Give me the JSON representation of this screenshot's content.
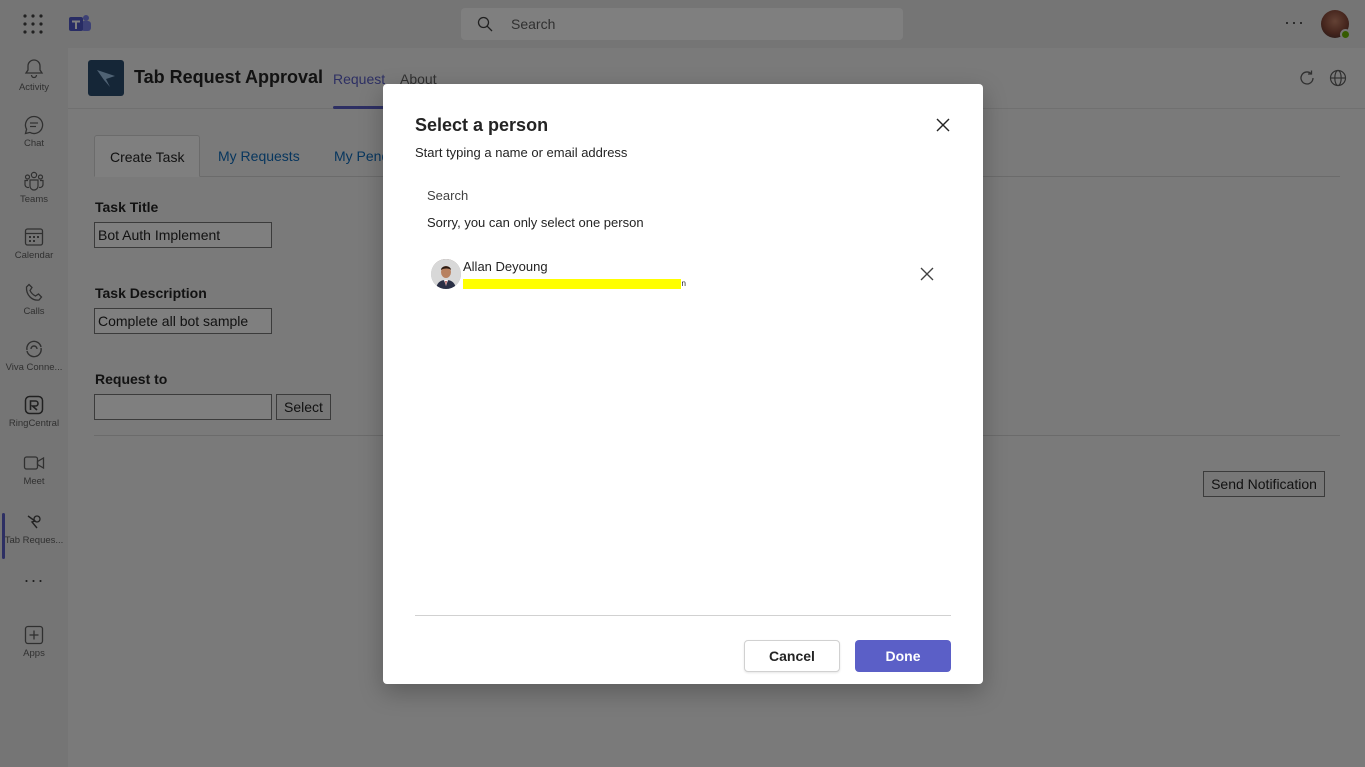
{
  "topbar": {
    "search_placeholder": "Search",
    "more_label": "···"
  },
  "rail": {
    "items": [
      {
        "label": "Activity",
        "icon": "bell-icon"
      },
      {
        "label": "Chat",
        "icon": "chat-icon"
      },
      {
        "label": "Teams",
        "icon": "teams-icon"
      },
      {
        "label": "Calendar",
        "icon": "calendar-icon"
      },
      {
        "label": "Calls",
        "icon": "phone-icon"
      },
      {
        "label": "Viva Conne...",
        "icon": "viva-icon"
      },
      {
        "label": "RingCentral",
        "icon": "ringcentral-icon"
      },
      {
        "label": "Meet",
        "icon": "video-icon"
      },
      {
        "label": "Tab Reques...",
        "icon": "tab-request-icon"
      },
      {
        "label": "Apps",
        "icon": "plus-square-icon"
      }
    ],
    "more_label": "···"
  },
  "app_header": {
    "title": "Tab Request Approval",
    "tabs": [
      {
        "label": "Request",
        "active": true
      },
      {
        "label": "About",
        "active": false
      }
    ]
  },
  "content": {
    "tabs": [
      {
        "label": "Create Task",
        "active": true
      },
      {
        "label": "My Requests",
        "active": false
      },
      {
        "label": "My Pending",
        "active": false
      }
    ],
    "task_title_label": "Task Title",
    "task_title_value": "Bot Auth Implement",
    "task_description_label": "Task Description",
    "task_description_value": "Complete all bot sample",
    "request_to_label": "Request to",
    "request_to_value": "",
    "select_button": "Select",
    "send_notification_button": "Send Notification"
  },
  "dialog": {
    "title": "Select a person",
    "subtitle": "Start typing a name or email address",
    "search_label": "Search",
    "warning": "Sorry, you can only select one person",
    "selected_person": {
      "name": "Allan Deyoung",
      "email_redacted": "n"
    },
    "cancel_button": "Cancel",
    "done_button": "Done"
  },
  "colors": {
    "accent": "#5b5fc7",
    "link": "#0f6cbd",
    "highlight": "#ffff00",
    "presence": "#6bb700"
  }
}
